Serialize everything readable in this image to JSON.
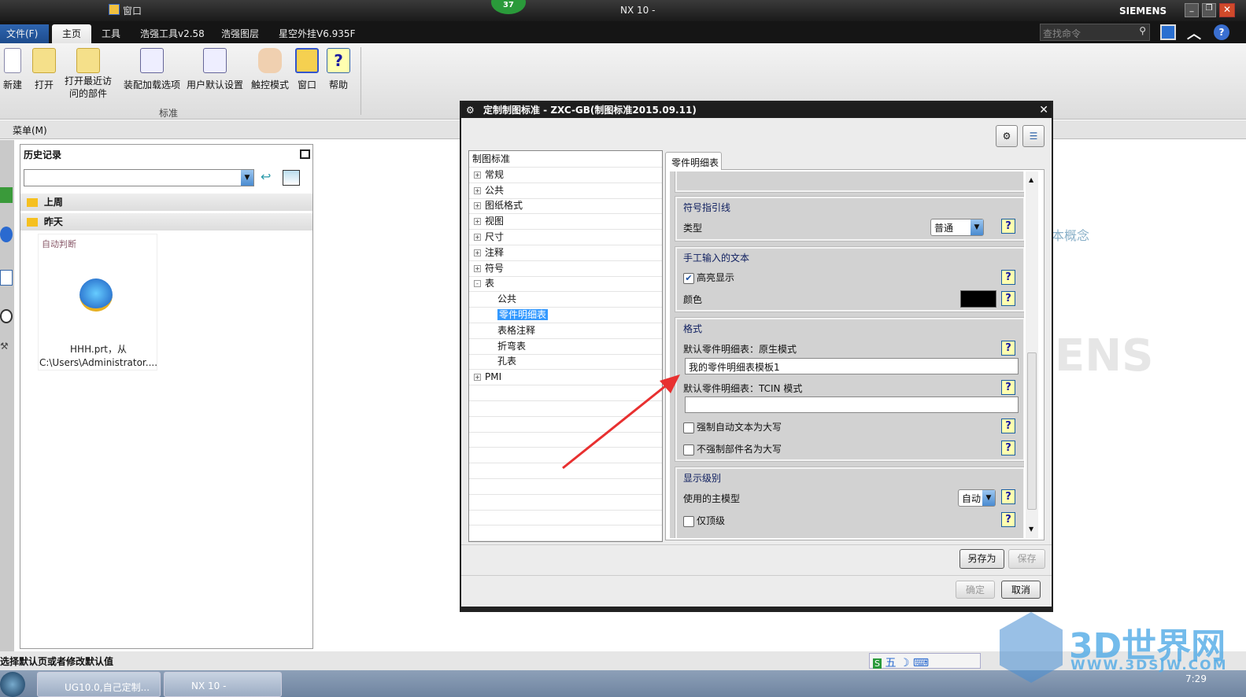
{
  "window": {
    "title": "NX 10 -",
    "brand": "SIEMENS",
    "badge": "37",
    "quick_access_window": "窗口"
  },
  "ribbon": {
    "tabs": [
      "文件(F)",
      "主页",
      "工具",
      "浩强工具v2.58",
      "浩强图层",
      "星空外挂V6.935F"
    ],
    "active_tab": "主页",
    "search_placeholder": "查找命令",
    "buttons": [
      {
        "label": "新建",
        "icon": "new-file-icon"
      },
      {
        "label": "打开",
        "icon": "open-folder-icon"
      },
      {
        "label": "打开最近访\n问的部件",
        "icon": "recent-folder-icon"
      },
      {
        "label": "装配加载选项",
        "icon": "assembly-load-icon"
      },
      {
        "label": "用户默认设置",
        "icon": "user-defaults-icon"
      },
      {
        "label": "触控模式",
        "icon": "touch-mode-icon"
      },
      {
        "label": "窗口",
        "icon": "window-icon"
      },
      {
        "label": "帮助",
        "icon": "help-icon"
      }
    ],
    "group_label": "标准"
  },
  "menu": {
    "label": "菜单(M)"
  },
  "history": {
    "title": "历史记录",
    "groups": [
      "上周",
      "昨天"
    ],
    "item": {
      "type": "自动判断",
      "line1": "HHH.prt，从",
      "line2": "C:\\Users\\Administrator...."
    }
  },
  "status": {
    "text": "选择默认页或者修改默认值"
  },
  "taskbar": {
    "items": [
      "UG10.0,自己定制...",
      "NX 10 -"
    ],
    "time": "7:29",
    "ime": "五"
  },
  "watermark": {
    "brand": "3D世界网",
    "url": "WWW.3DSJW.COM",
    "bg_text1": "本概念",
    "bg_text2": "ENS"
  },
  "dialog": {
    "title": "定制制图标准 - ZXC-GB(制图标准2015.09.11)",
    "tree": [
      {
        "label": "制图标准",
        "level": 0,
        "expander": ""
      },
      {
        "label": "常规",
        "level": 1,
        "expander": "+"
      },
      {
        "label": "公共",
        "level": 1,
        "expander": "+"
      },
      {
        "label": "图纸格式",
        "level": 1,
        "expander": "+"
      },
      {
        "label": "视图",
        "level": 1,
        "expander": "+"
      },
      {
        "label": "尺寸",
        "level": 1,
        "expander": "+"
      },
      {
        "label": "注释",
        "level": 1,
        "expander": "+"
      },
      {
        "label": "符号",
        "level": 1,
        "expander": "+"
      },
      {
        "label": "表",
        "level": 1,
        "expander": "-"
      },
      {
        "label": "公共",
        "level": 2,
        "expander": ""
      },
      {
        "label": "零件明细表",
        "level": 2,
        "expander": "",
        "selected": true
      },
      {
        "label": "表格注释",
        "level": 2,
        "expander": ""
      },
      {
        "label": "折弯表",
        "level": 2,
        "expander": ""
      },
      {
        "label": "孔表",
        "level": 2,
        "expander": ""
      },
      {
        "label": "PMI",
        "level": 1,
        "expander": "+"
      }
    ],
    "tab": "零件明细表",
    "leader": {
      "title": "符号指引线",
      "type_label": "类型",
      "type_value": "普通"
    },
    "manual_text": {
      "title": "手工输入的文本",
      "highlight_label": "高亮显示",
      "highlight_checked": true,
      "color_label": "颜色",
      "color": "#000000"
    },
    "format": {
      "title": "格式",
      "native_label": "默认零件明细表：原生模式",
      "native_value": "我的零件明细表模板1",
      "tcin_label": "默认零件明细表：TCIN 模式",
      "tcin_value": "",
      "force_upper_label": "强制自动文本为大写",
      "force_upper_checked": false,
      "no_force_part_label": "不强制部件名为大写",
      "no_force_part_checked": false
    },
    "display_level": {
      "title": "显示级别",
      "master_label": "使用的主模型",
      "master_value": "自动",
      "top_only_label": "仅顶级",
      "top_only_checked": false
    },
    "buttons": {
      "save_as": "另存为",
      "save": "保存",
      "ok": "确定",
      "cancel": "取消"
    },
    "help_glyph": "?"
  },
  "colors": {
    "selection": "#3399ff",
    "annotation_arrow": "#e83030"
  }
}
